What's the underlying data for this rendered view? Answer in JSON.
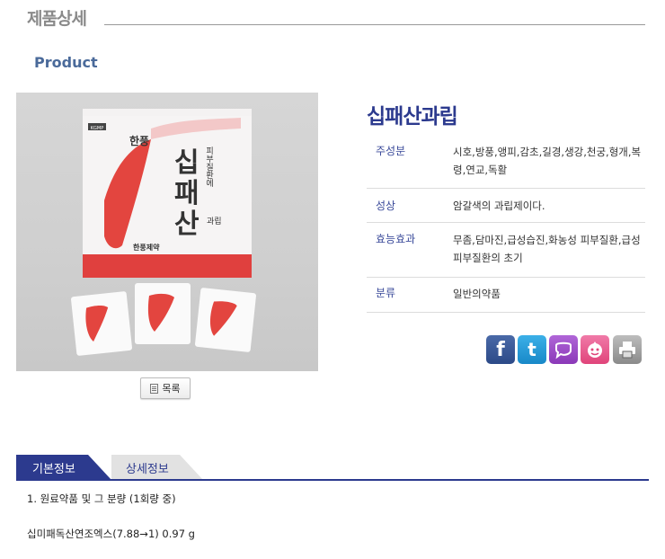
{
  "header": {
    "title": "제품상세",
    "subtitle": "Product"
  },
  "product": {
    "name": "십패산과립",
    "list_button": "목록",
    "package": {
      "mark": "KGMP",
      "prefix": "한풍",
      "name_vertical": [
        "십",
        "패",
        "산"
      ],
      "side_text": "피부질환에",
      "form": "과립",
      "maker": "한풍제약"
    }
  },
  "specs": [
    {
      "label": "주성분",
      "value": "시호,방풍,앵피,감초,길경,생강,천궁,형개,복령,연교,독활"
    },
    {
      "label": "성상",
      "value": "암갈색의 과립제이다."
    },
    {
      "label": "효능효과",
      "value": "무좀,담마진,급성습진,화농성 피부질환,급성피부질환의 초기"
    },
    {
      "label": "분류",
      "value": "일반의약품"
    }
  ],
  "share": [
    {
      "name": "facebook",
      "glyph": "f",
      "color": "#3b5998"
    },
    {
      "name": "twitter",
      "glyph": "t",
      "color": "#1da1f2"
    },
    {
      "name": "me2day",
      "glyph": "",
      "color": "#9b4ac8"
    },
    {
      "name": "cyworld",
      "glyph": "",
      "color": "#e8508a"
    },
    {
      "name": "print",
      "glyph": "",
      "color": "#8a8a8a"
    }
  ],
  "tabs": [
    {
      "label": "기본정보",
      "active": true
    },
    {
      "label": "상세정보",
      "active": false
    }
  ],
  "content": {
    "line1": "1. 원료약품 및 그 분량 (1회량 중)",
    "line2": "십미패독산연조엑스(7.88→1) 0.97 g"
  },
  "colors": {
    "accent": "#2c3a8e",
    "label": "#3a4a9a",
    "product_red": "#e8403a"
  }
}
